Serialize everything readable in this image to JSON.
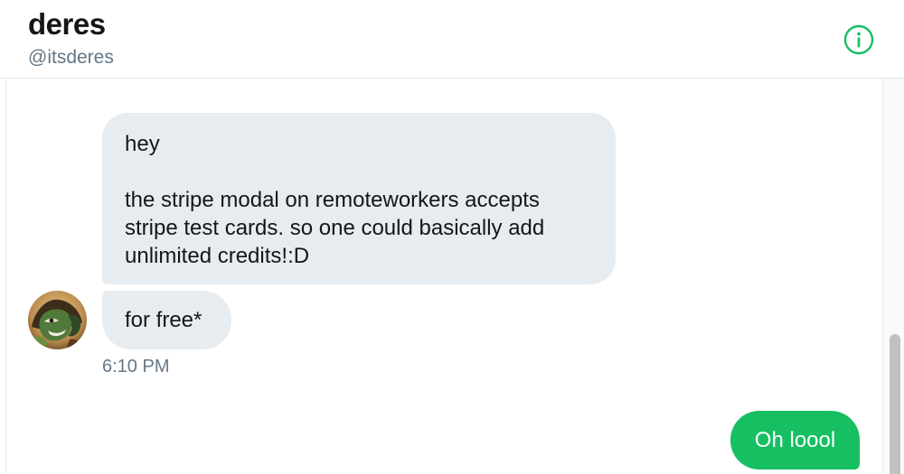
{
  "header": {
    "name": "deres",
    "handle": "@itsderes",
    "info_icon": "info-icon",
    "accent_color": "#17bf63"
  },
  "messages": {
    "received": [
      {
        "lines": [
          "hey",
          "",
          "the stripe modal on remoteworkers accepts",
          "stripe test cards. so one could basically add",
          "unlimited credits!:D"
        ]
      },
      {
        "lines": [
          "for free*"
        ]
      }
    ],
    "received_timestamp": "6:10 PM",
    "sent": [
      {
        "text": "Oh loool"
      }
    ]
  },
  "colors": {
    "received_bubble": "#e6ecf0",
    "sent_bubble": "#17bf63",
    "text_primary": "#14171a",
    "text_secondary": "#657786"
  }
}
